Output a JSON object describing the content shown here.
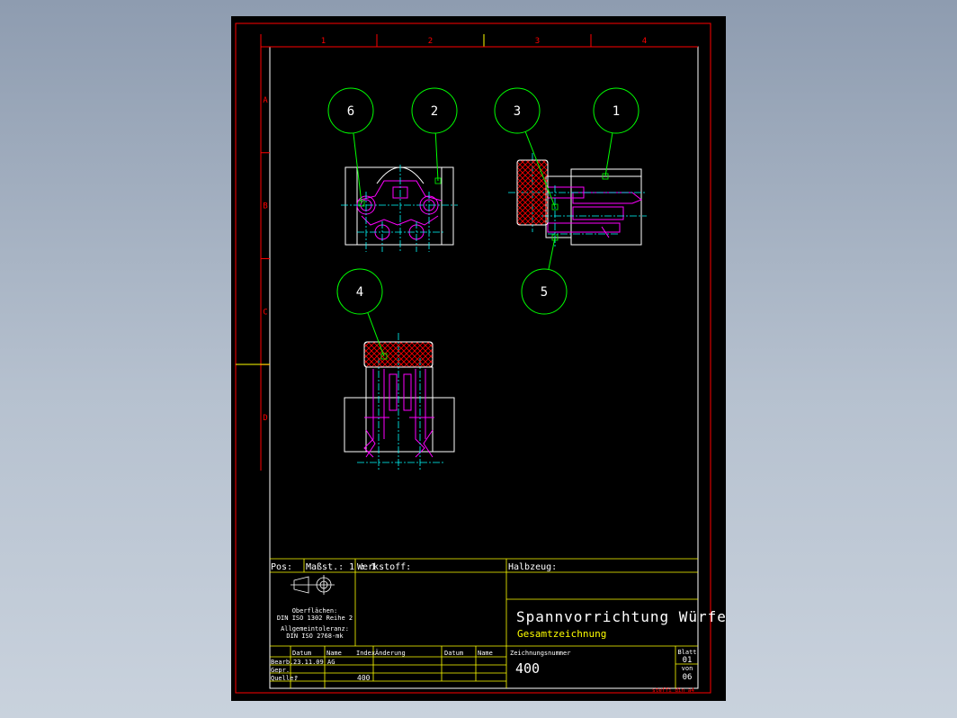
{
  "colors": {
    "frame": "#ff0000",
    "title_lines": "#ffff00",
    "geometry": "#ffffff",
    "hidden": "#ff00ff",
    "center": "#00ffff",
    "balloon": "#00ff00",
    "hatch": "#ff0000",
    "text": "#ffffff"
  },
  "frame": {
    "columns": [
      "1",
      "2",
      "3",
      "4"
    ],
    "rows": [
      "A",
      "B",
      "C",
      "D"
    ]
  },
  "balloons": [
    "6",
    "2",
    "3",
    "1",
    "4",
    "5"
  ],
  "title_block": {
    "pos_label": "Pos:",
    "scale_label": "Maßst.: 1 : 1",
    "material_label": "Werkstoff:",
    "semi_label": "Halbzeug:",
    "surface_label": "Oberflächen:",
    "surface_value": "DIN ISO 1302 Reihe 2",
    "tolerance_label": "Allgemeintoleranz:",
    "tolerance_value": "DIN ISO 2768-mk",
    "title": "Spannvorrichtung Würfel",
    "subtitle": "Gesamtzeichnung",
    "col_datum": "Datum",
    "col_name": "Name",
    "col_index": "Index",
    "col_change": "Änderung",
    "col_datum2": "Datum",
    "col_name2": "Name",
    "drawing_no_label": "Zeichnungsnummer",
    "drawing_no": "400",
    "row_bearb": "Bearb.",
    "bearb_date": "23.11.09",
    "bearb_name": "AG",
    "row_gepr": "Gepr.",
    "row_quelle": "Quelle:",
    "quelle_value": "?",
    "index_value": "400",
    "sheet_label": "Blatt",
    "sheet_no": "01",
    "of_label": "von",
    "sheet_total": "06",
    "file_tag": "steffi_din_a4"
  }
}
